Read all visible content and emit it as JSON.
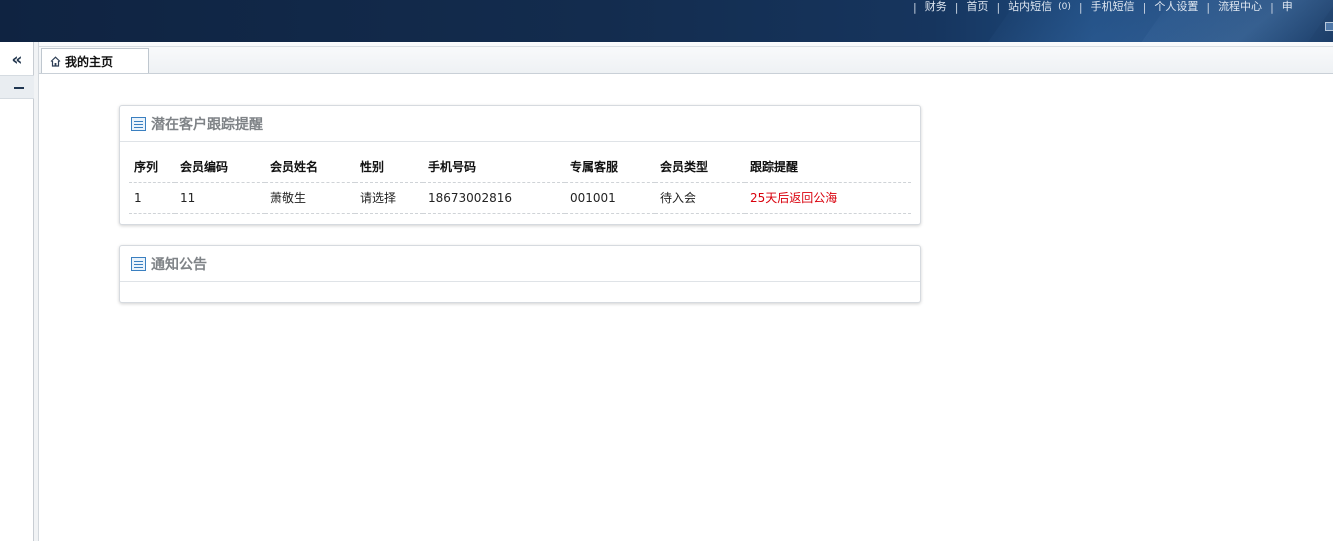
{
  "header": {
    "nav": [
      {
        "label": "财务"
      },
      {
        "label": "首页"
      },
      {
        "label": "站内短信",
        "count": "(0)"
      },
      {
        "label": "手机短信"
      },
      {
        "label": "个人设置"
      },
      {
        "label": "流程中心"
      },
      {
        "label": "申"
      }
    ]
  },
  "tabs": [
    {
      "label": "我的主页",
      "icon": "home-icon"
    }
  ],
  "panels": {
    "tracking": {
      "title": "潜在客户跟踪提醒",
      "columns": [
        "序列",
        "会员编码",
        "会员姓名",
        "性别",
        "手机号码",
        "专属客服",
        "会员类型",
        "跟踪提醒"
      ],
      "rows": [
        [
          "1",
          "11",
          "萧敬生",
          "请选择",
          "18673002816",
          "001001",
          "待入会",
          "25天后返回公海"
        ]
      ],
      "alert_color": "#d9000c"
    },
    "notice": {
      "title": "通知公告"
    }
  },
  "icons": {
    "collapse": "double-chevron-left-icon",
    "section": "list-icon"
  }
}
